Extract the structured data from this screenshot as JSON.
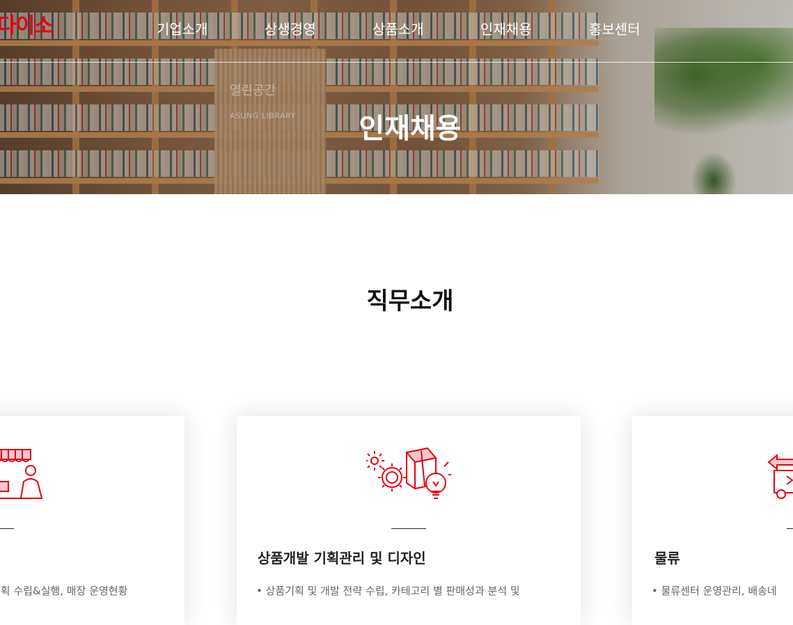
{
  "brand": {
    "logo_text": "다이소",
    "accent_color": "#e60012"
  },
  "nav": {
    "items": [
      {
        "label": "기업소개"
      },
      {
        "label": "상생경영"
      },
      {
        "label": "상품소개"
      },
      {
        "label": "인재채용"
      },
      {
        "label": "홍보센터"
      }
    ]
  },
  "hero": {
    "title": "인재채용",
    "library_sign": "열린공간",
    "library_sign_sub": "ASUNG LIBRARY"
  },
  "section": {
    "title": "직무소개",
    "cards": [
      {
        "icon": "store-clerk-icon",
        "title": "",
        "desc": "계획 수립&실행, 매장 운영현황"
      },
      {
        "icon": "product-development-icon",
        "title": "상품개발 기획관리 및 디자인",
        "desc": "• 상품기획 및 개발 전략 수립, 카테고리 별 판매성과 분석 및"
      },
      {
        "icon": "delivery-truck-icon",
        "title": "물류",
        "desc": "• 물류센터 운영관리, 배송네"
      }
    ]
  }
}
